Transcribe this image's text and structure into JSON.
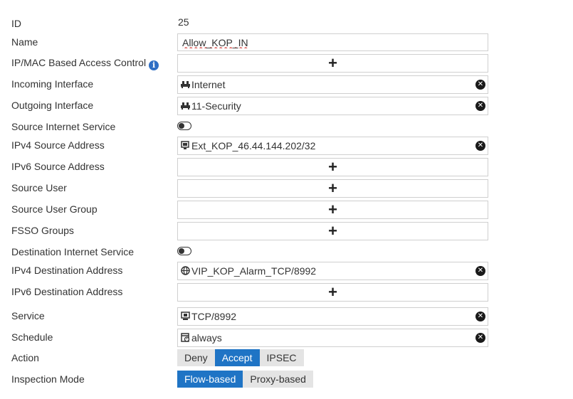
{
  "form": {
    "id": {
      "label": "ID",
      "value": "25"
    },
    "name": {
      "label": "Name",
      "value": "Allow_KOP_IN"
    },
    "ipmac": {
      "label": "IP/MAC Based Access Control",
      "info": "i"
    },
    "incoming_interface": {
      "label": "Incoming Interface",
      "value": "Internet",
      "icon": "network-interface-icon"
    },
    "outgoing_interface": {
      "label": "Outgoing Interface",
      "value": "11-Security",
      "icon": "network-interface-icon"
    },
    "source_internet_service": {
      "label": "Source Internet Service",
      "enabled": false
    },
    "ipv4_source": {
      "label": "IPv4 Source Address",
      "value": "Ext_KOP_46.44.144.202/32",
      "icon": "address-object-icon"
    },
    "ipv6_source": {
      "label": "IPv6 Source Address"
    },
    "source_user": {
      "label": "Source User"
    },
    "source_user_group": {
      "label": "Source User Group"
    },
    "fsso_groups": {
      "label": "FSSO Groups"
    },
    "destination_internet_service": {
      "label": "Destination Internet Service",
      "enabled": false
    },
    "ipv4_destination": {
      "label": "IPv4 Destination Address",
      "value": "VIP_KOP_Alarm_TCP/8992",
      "icon": "virtual-ip-icon"
    },
    "ipv6_destination": {
      "label": "IPv6 Destination Address"
    },
    "service": {
      "label": "Service",
      "value": "TCP/8992",
      "icon": "service-icon"
    },
    "schedule": {
      "label": "Schedule",
      "value": "always",
      "icon": "schedule-icon"
    },
    "action": {
      "label": "Action",
      "options": [
        "Deny",
        "Accept",
        "IPSEC"
      ],
      "selected": "Accept"
    },
    "inspection_mode": {
      "label": "Inspection Mode",
      "options": [
        "Flow-based",
        "Proxy-based"
      ],
      "selected": "Flow-based"
    }
  },
  "symbols": {
    "plus": "+",
    "remove": "✕"
  },
  "colors": {
    "accent": "#1f74c5",
    "info": "#2f6fc4",
    "spellcheck": "#d9534f"
  }
}
